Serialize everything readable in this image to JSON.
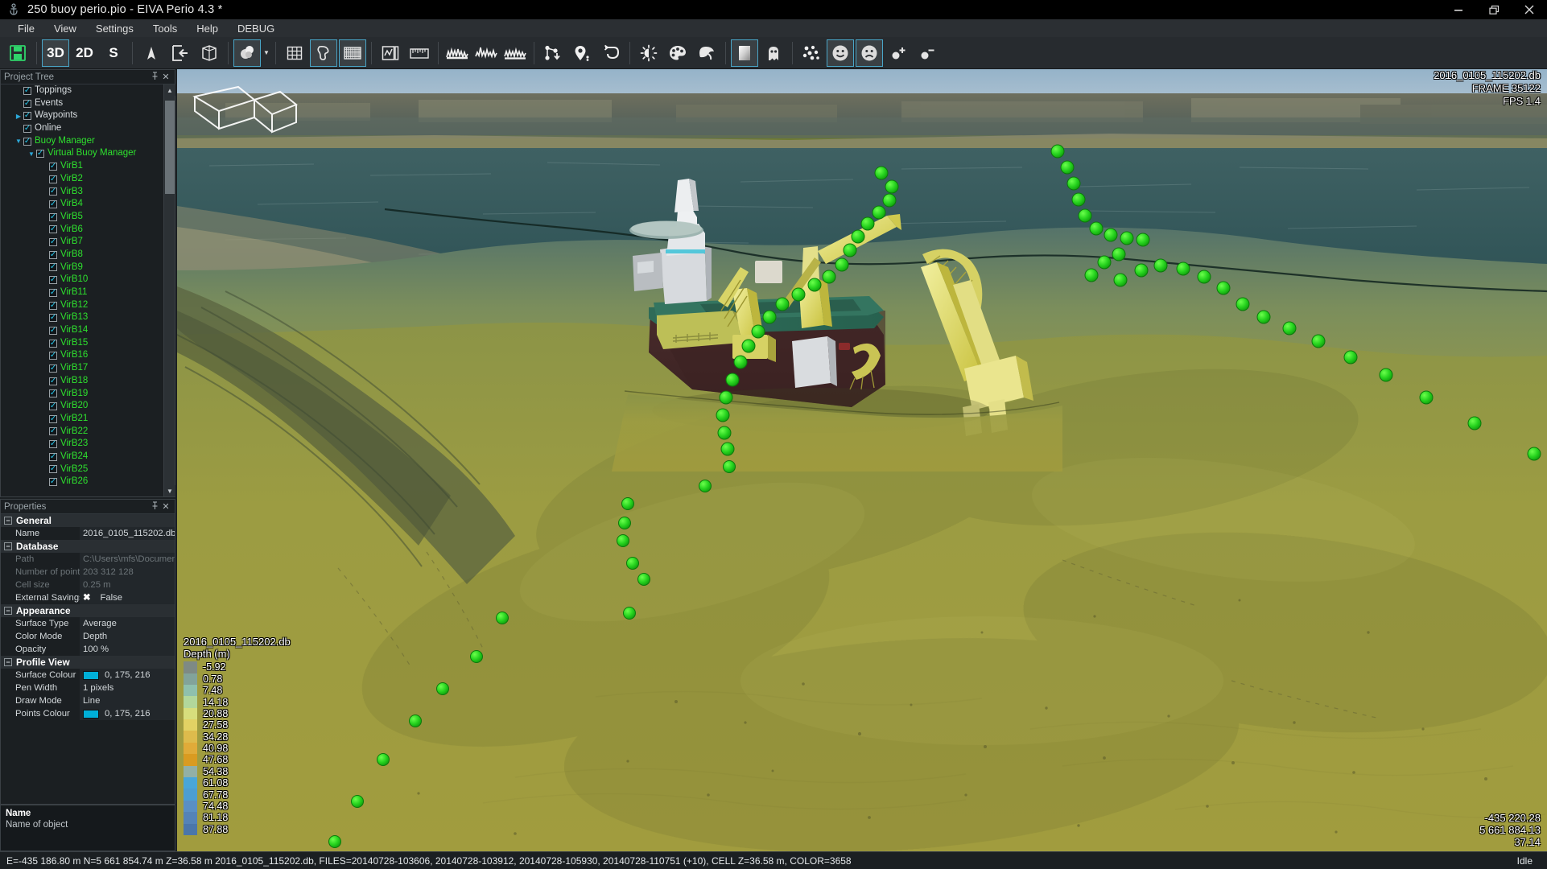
{
  "window": {
    "title": "250 buoy perio.pio - EIVA Perio 4.3 *",
    "app_icon": "anchor-icon",
    "minimize": "–",
    "maximize": "❐",
    "close": "✕"
  },
  "menu": {
    "items": [
      {
        "label": "File"
      },
      {
        "label": "View"
      },
      {
        "label": "Settings"
      },
      {
        "label": "Tools"
      },
      {
        "label": "Help"
      },
      {
        "label": "DEBUG"
      }
    ]
  },
  "toolbar": {
    "brand": "EIVA",
    "groups": [
      {
        "name": "file",
        "buttons": [
          {
            "name": "save-button",
            "icon": "floppy-save-icon",
            "label": "",
            "active": false
          }
        ]
      },
      {
        "name": "view-mode",
        "buttons": [
          {
            "name": "view-3d-button",
            "icon": "text-icon",
            "label": "3D",
            "active": true
          },
          {
            "name": "view-2d-button",
            "icon": "text-icon",
            "label": "2D",
            "active": false
          },
          {
            "name": "view-s-button",
            "icon": "text-icon",
            "label": "S",
            "active": false
          }
        ]
      },
      {
        "name": "navigation",
        "buttons": [
          {
            "name": "north-arrow-button",
            "icon": "north-arrow-icon",
            "label": "",
            "active": false
          },
          {
            "name": "view-from-left-button",
            "icon": "view-enter-box-icon",
            "label": "",
            "active": false
          },
          {
            "name": "bounding-box-button",
            "icon": "wireframe-box-icon",
            "label": "",
            "active": false
          }
        ]
      },
      {
        "name": "rendering",
        "buttons": [
          {
            "name": "lighting-button",
            "icon": "sphere-shading-icon",
            "label": "",
            "active": true,
            "has_dropdown": true
          }
        ]
      },
      {
        "name": "grid-tools",
        "buttons": [
          {
            "name": "grid-button",
            "icon": "grid-icon",
            "label": "",
            "active": false
          },
          {
            "name": "coastline-button",
            "icon": "coastline-icon",
            "label": "",
            "active": true
          },
          {
            "name": "dense-grid-button",
            "icon": "dense-grid-icon",
            "label": "",
            "active": true
          }
        ]
      },
      {
        "name": "chart-tools",
        "buttons": [
          {
            "name": "profile-plot-button",
            "icon": "profile-plot-icon",
            "label": "",
            "active": false
          },
          {
            "name": "ruler-button",
            "icon": "ruler-icon",
            "label": "",
            "active": false
          }
        ]
      },
      {
        "name": "sonar-tools",
        "buttons": [
          {
            "name": "waveform-1-button",
            "icon": "waveform-icon",
            "label": "",
            "active": false
          },
          {
            "name": "waveform-2-button",
            "icon": "waveform-spike-icon",
            "label": "",
            "active": false
          },
          {
            "name": "waveform-3-button",
            "icon": "waveform-double-icon",
            "label": "",
            "active": false
          }
        ]
      },
      {
        "name": "survey-tools",
        "buttons": [
          {
            "name": "route-node-button",
            "icon": "route-node-icon",
            "label": "",
            "active": false
          },
          {
            "name": "waypoint-pin-button",
            "icon": "map-pin-icon",
            "label": "",
            "active": false
          },
          {
            "name": "turn-path-button",
            "icon": "turn-arrow-icon",
            "label": "",
            "active": false
          }
        ]
      },
      {
        "name": "appearance",
        "buttons": [
          {
            "name": "brightness-button",
            "icon": "brightness-icon",
            "label": "",
            "active": false
          },
          {
            "name": "palette-button",
            "icon": "palette-icon",
            "label": "",
            "active": false
          },
          {
            "name": "paint-button",
            "icon": "paint-bucket-icon",
            "label": "",
            "active": false
          }
        ]
      },
      {
        "name": "display",
        "buttons": [
          {
            "name": "gradient-button",
            "icon": "gradient-square-icon",
            "label": "",
            "active": true
          },
          {
            "name": "ghost-button",
            "icon": "ghost-icon",
            "label": "",
            "active": false
          }
        ]
      },
      {
        "name": "points",
        "buttons": [
          {
            "name": "scatter-points-button",
            "icon": "scatter-dots-icon",
            "label": "",
            "active": false
          },
          {
            "name": "accept-face-button",
            "icon": "smiley-happy-icon",
            "label": "",
            "active": true
          },
          {
            "name": "reject-face-button",
            "icon": "smiley-sad-icon",
            "label": "",
            "active": true
          },
          {
            "name": "add-point-button",
            "icon": "dot-plus-icon",
            "label": "",
            "active": false
          },
          {
            "name": "remove-point-button",
            "icon": "dot-minus-icon",
            "label": "",
            "active": false
          }
        ]
      }
    ]
  },
  "project_tree": {
    "title": "Project Tree",
    "pin": "pin-icon",
    "close": "✕",
    "nodes": [
      {
        "label": "Toppings",
        "indent": 1,
        "checked": true,
        "twisty": "",
        "green": false
      },
      {
        "label": "Events",
        "indent": 1,
        "checked": true,
        "twisty": "",
        "green": false
      },
      {
        "label": "Waypoints",
        "indent": 1,
        "checked": true,
        "twisty": "▶",
        "green": false
      },
      {
        "label": "Online",
        "indent": 1,
        "checked": true,
        "twisty": "",
        "green": false
      },
      {
        "label": "Buoy Manager",
        "indent": 1,
        "checked": true,
        "twisty": "▼",
        "green": true
      },
      {
        "label": "Virtual Buoy Manager",
        "indent": 2,
        "checked": true,
        "twisty": "▼",
        "green": true
      },
      {
        "label": "VirB1",
        "indent": 3,
        "checked": true,
        "twisty": "",
        "green": true
      },
      {
        "label": "VirB2",
        "indent": 3,
        "checked": true,
        "twisty": "",
        "green": true
      },
      {
        "label": "VirB3",
        "indent": 3,
        "checked": true,
        "twisty": "",
        "green": true
      },
      {
        "label": "VirB4",
        "indent": 3,
        "checked": true,
        "twisty": "",
        "green": true
      },
      {
        "label": "VirB5",
        "indent": 3,
        "checked": true,
        "twisty": "",
        "green": true
      },
      {
        "label": "VirB6",
        "indent": 3,
        "checked": true,
        "twisty": "",
        "green": true
      },
      {
        "label": "VirB7",
        "indent": 3,
        "checked": true,
        "twisty": "",
        "green": true
      },
      {
        "label": "VirB8",
        "indent": 3,
        "checked": true,
        "twisty": "",
        "green": true
      },
      {
        "label": "VirB9",
        "indent": 3,
        "checked": true,
        "twisty": "",
        "green": true
      },
      {
        "label": "VirB10",
        "indent": 3,
        "checked": true,
        "twisty": "",
        "green": true
      },
      {
        "label": "VirB11",
        "indent": 3,
        "checked": true,
        "twisty": "",
        "green": true
      },
      {
        "label": "VirB12",
        "indent": 3,
        "checked": true,
        "twisty": "",
        "green": true
      },
      {
        "label": "VirB13",
        "indent": 3,
        "checked": true,
        "twisty": "",
        "green": true
      },
      {
        "label": "VirB14",
        "indent": 3,
        "checked": true,
        "twisty": "",
        "green": true
      },
      {
        "label": "VirB15",
        "indent": 3,
        "checked": true,
        "twisty": "",
        "green": true
      },
      {
        "label": "VirB16",
        "indent": 3,
        "checked": true,
        "twisty": "",
        "green": true
      },
      {
        "label": "VirB17",
        "indent": 3,
        "checked": true,
        "twisty": "",
        "green": true
      },
      {
        "label": "VirB18",
        "indent": 3,
        "checked": true,
        "twisty": "",
        "green": true
      },
      {
        "label": "VirB19",
        "indent": 3,
        "checked": true,
        "twisty": "",
        "green": true
      },
      {
        "label": "VirB20",
        "indent": 3,
        "checked": true,
        "twisty": "",
        "green": true
      },
      {
        "label": "VirB21",
        "indent": 3,
        "checked": true,
        "twisty": "",
        "green": true
      },
      {
        "label": "VirB22",
        "indent": 3,
        "checked": true,
        "twisty": "",
        "green": true
      },
      {
        "label": "VirB23",
        "indent": 3,
        "checked": true,
        "twisty": "",
        "green": true
      },
      {
        "label": "VirB24",
        "indent": 3,
        "checked": true,
        "twisty": "",
        "green": true
      },
      {
        "label": "VirB25",
        "indent": 3,
        "checked": true,
        "twisty": "",
        "green": true
      },
      {
        "label": "VirB26",
        "indent": 3,
        "checked": true,
        "twisty": "",
        "green": true
      }
    ]
  },
  "properties": {
    "title": "Properties",
    "pin": "pin-icon",
    "close": "✕",
    "rows": [
      {
        "type": "group",
        "key": "General"
      },
      {
        "type": "row",
        "key": "Name",
        "value": "2016_0105_115202.db",
        "dim": false
      },
      {
        "type": "group",
        "key": "Database"
      },
      {
        "type": "row",
        "key": "Path",
        "value": "C:\\Users\\mfs\\Documen",
        "dim": true
      },
      {
        "type": "row",
        "key": "Number of points",
        "value": "203 312 128",
        "dim": true
      },
      {
        "type": "row",
        "key": "Cell size",
        "value": "0.25 m",
        "dim": true
      },
      {
        "type": "row",
        "key": "External Savings",
        "value": "False",
        "dim": false,
        "prefix_icon": "cross-icon"
      },
      {
        "type": "group",
        "key": "Appearance"
      },
      {
        "type": "row",
        "key": "Surface Type",
        "value": "Average",
        "dim": false
      },
      {
        "type": "row",
        "key": "Color Mode",
        "value": "Depth",
        "dim": false
      },
      {
        "type": "row",
        "key": "Opacity",
        "value": "100 %",
        "dim": false
      },
      {
        "type": "group",
        "key": "Profile View"
      },
      {
        "type": "row",
        "key": "Surface Colour",
        "value": "0, 175, 216",
        "dim": false,
        "swatch": "#00afd8"
      },
      {
        "type": "row",
        "key": "Pen Width",
        "value": "1 pixels",
        "dim": false
      },
      {
        "type": "row",
        "key": "Draw Mode",
        "value": "Line",
        "dim": false
      },
      {
        "type": "row",
        "key": "Points Colour",
        "value": "0, 175, 216",
        "dim": false,
        "swatch": "#00afd8"
      }
    ]
  },
  "description": {
    "title": "Name",
    "text": "Name of object"
  },
  "viewport": {
    "overlay_top_right": {
      "database": "2016_0105_115202.db",
      "frame": "FRAME 35122",
      "fps": "FPS 1.4"
    },
    "overlay_bottom_right": {
      "easting": "-435 220.28",
      "northing": "5 661 884.13",
      "depth": "37.14"
    },
    "compass": "north-arrow-gizmo"
  },
  "chart_data": {
    "type": "heatmap",
    "title": "2016_0105_115202.db",
    "subtitle": "Depth (m)",
    "ylabel": "Depth (m)",
    "legend_position": "bottom-left",
    "grid": false,
    "categories": [
      "-5.92",
      "0.78",
      "7.48",
      "14.18",
      "20.88",
      "27.58",
      "34.28",
      "40.98",
      "47.68",
      "54.38",
      "61.08",
      "67.78",
      "74.48",
      "81.18",
      "87.88"
    ],
    "values": [
      -5.92,
      0.78,
      7.48,
      14.18,
      20.88,
      27.58,
      34.28,
      40.98,
      47.68,
      54.38,
      61.08,
      67.78,
      74.48,
      81.18,
      87.88
    ],
    "colors": [
      "#7e8a84",
      "#82a39a",
      "#8fc0ad",
      "#b2d79b",
      "#d7de7c",
      "#e2d264",
      "#ddbb4c",
      "#e0ab39",
      "#d99b21",
      "#92b0a6",
      "#49a6d8",
      "#4c9ed2",
      "#5a8fc4",
      "#5483b8",
      "#4a76ab"
    ],
    "xlabel": "",
    "ylim": [
      -5.92,
      87.88
    ]
  },
  "status_bar": {
    "main": "E=-435 186.80 m N=5 661 854.74 m Z=36.58 m 2016_0105_115202.db, FILES=20140728-103606, 20140728-103912, 20140728-105930, 20140728-110751 (+10), CELL Z=36.58 m, COLOR=3658",
    "right": "Idle"
  }
}
